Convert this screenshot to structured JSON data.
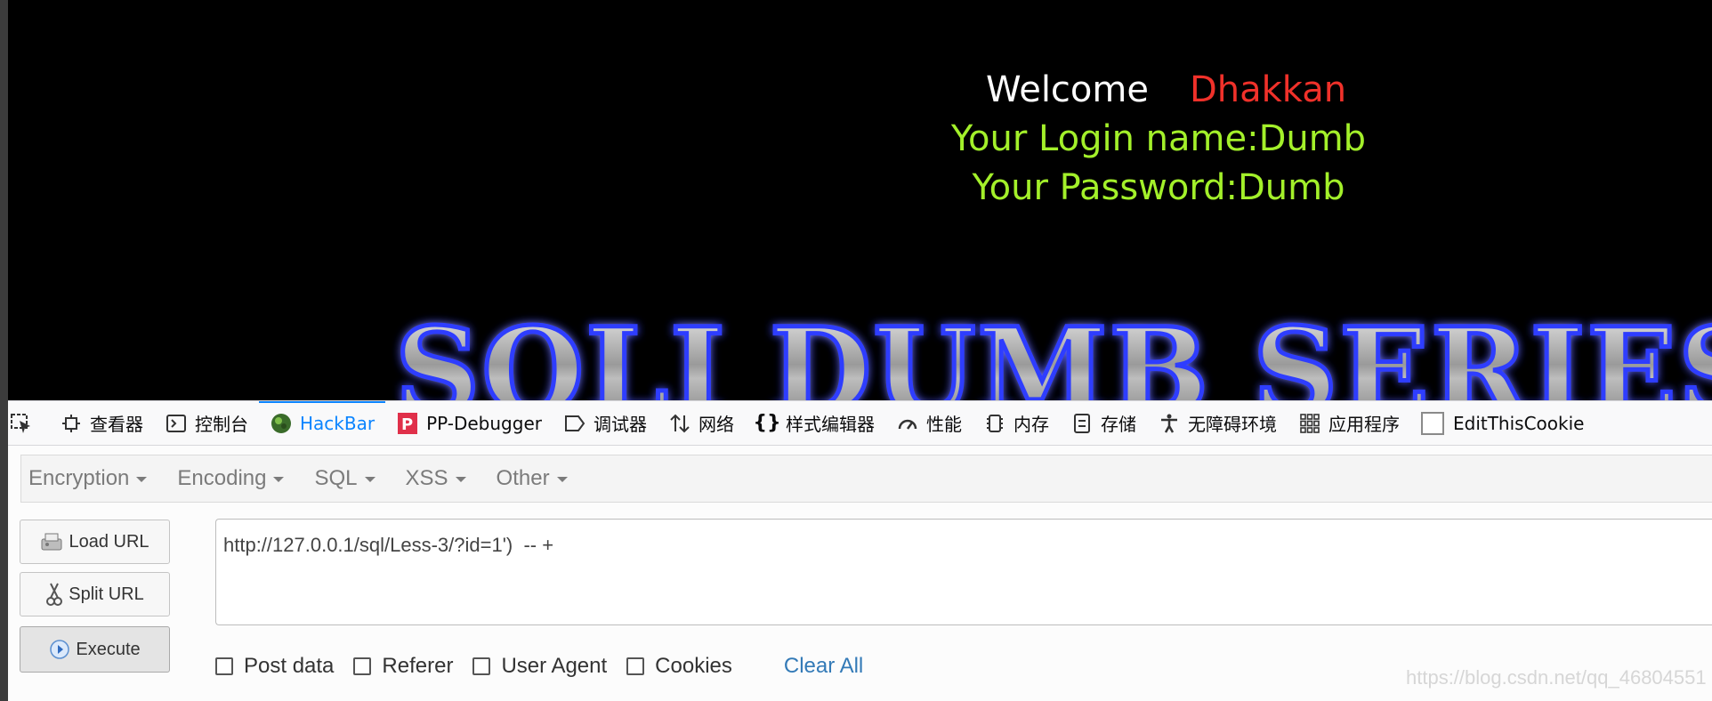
{
  "page": {
    "welcome_label": "Welcome",
    "welcome_user": "Dhakkan",
    "login_line": "Your Login name:Dumb",
    "password_line": "Your Password:Dumb",
    "banner_text": "SQLI DUMB SERIES"
  },
  "devtools": {
    "tabs": [
      {
        "label": "查看器",
        "icon": "inspector-icon"
      },
      {
        "label": "控制台",
        "icon": "console-icon"
      },
      {
        "label": "HackBar",
        "icon": "hackbar-icon",
        "active": true
      },
      {
        "label": "PP-Debugger",
        "icon": "pp-debugger-icon"
      },
      {
        "label": "调试器",
        "icon": "debugger-icon"
      },
      {
        "label": "网络",
        "icon": "network-icon"
      },
      {
        "label": "样式编辑器",
        "icon": "style-editor-icon"
      },
      {
        "label": "性能",
        "icon": "performance-icon"
      },
      {
        "label": "内存",
        "icon": "memory-icon"
      },
      {
        "label": "存储",
        "icon": "storage-icon"
      },
      {
        "label": "无障碍环境",
        "icon": "accessibility-icon"
      },
      {
        "label": "应用程序",
        "icon": "application-icon"
      },
      {
        "label": "EditThisCookie",
        "icon": "cookie-icon"
      }
    ],
    "accent_color": "#0a84ff"
  },
  "hackbar": {
    "menu": [
      "Encryption",
      "Encoding",
      "SQL",
      "XSS",
      "Other"
    ],
    "buttons": {
      "load_url": "Load URL",
      "split_url": "Split URL",
      "execute": "Execute"
    },
    "url_value": "http://127.0.0.1/sql/Less-3/?id=1')  -- +",
    "options": [
      "Post data",
      "Referer",
      "User Agent",
      "Cookies"
    ],
    "clear_all": "Clear All"
  },
  "watermark": "https://blog.csdn.net/qq_46804551"
}
